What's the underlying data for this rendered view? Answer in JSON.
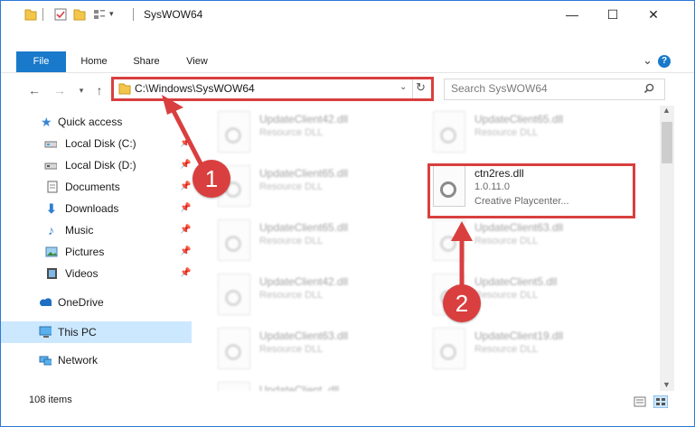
{
  "window": {
    "title": "SysWOW64",
    "minimize_glyph": "—",
    "maximize_glyph": "☐",
    "close_glyph": "✕"
  },
  "ribbon": {
    "tabs": [
      {
        "label": "File"
      },
      {
        "label": "Home"
      },
      {
        "label": "Share"
      },
      {
        "label": "View"
      }
    ],
    "expand_glyph": "⌄",
    "help_glyph": "?"
  },
  "address": {
    "path": "C:\\Windows\\SysWOW64",
    "search_placeholder": "Search SysWOW64"
  },
  "nav": {
    "items": [
      {
        "label": "Quick access",
        "icon": "star-icon",
        "pinned": false
      },
      {
        "label": "Local Disk (C:)",
        "icon": "drive-icon",
        "pinned": true
      },
      {
        "label": "Local Disk (D:)",
        "icon": "drive-icon",
        "pinned": true
      },
      {
        "label": "Documents",
        "icon": "documents-icon",
        "pinned": true
      },
      {
        "label": "Downloads",
        "icon": "downloads-icon",
        "pinned": true
      },
      {
        "label": "Music",
        "icon": "music-icon",
        "pinned": true
      },
      {
        "label": "Pictures",
        "icon": "pictures-icon",
        "pinned": true
      },
      {
        "label": "Videos",
        "icon": "videos-icon",
        "pinned": true
      },
      {
        "label": "OneDrive",
        "icon": "onedrive-icon",
        "pinned": false
      },
      {
        "label": "This PC",
        "icon": "pc-icon",
        "pinned": false,
        "selected": true
      },
      {
        "label": "Network",
        "icon": "network-icon",
        "pinned": false
      }
    ]
  },
  "files": {
    "left": [
      {
        "name": "UpdateClient42.dll",
        "type": "Resource DLL"
      },
      {
        "name": "UpdateClient65.dll",
        "type": "Resource DLL"
      },
      {
        "name": "UpdateClient65.dll",
        "type": "Resource DLL"
      },
      {
        "name": "UpdateClient42.dll",
        "type": "Resource DLL"
      },
      {
        "name": "UpdateClient63.dll",
        "type": "Resource DLL"
      },
      {
        "name": "UpdateClient..dll",
        "type": ""
      }
    ],
    "right": [
      {
        "name": "UpdateClient65.dll",
        "type": "Resource DLL"
      },
      {
        "name": "UpdateClient63.dll",
        "type": "Resource DLL"
      },
      {
        "name": "UpdateClient5.dll",
        "type": "Resource DLL"
      },
      {
        "name": "UpdateClient19.dll",
        "type": "Resource DLL"
      }
    ],
    "selected": {
      "name": "ctn2res.dll",
      "version": "1.0.11.0",
      "description": "Creative Playcenter..."
    }
  },
  "annotations": {
    "badge1": "1",
    "badge2": "2",
    "accent": "#d93f3f"
  },
  "status": {
    "items": "108 items"
  }
}
